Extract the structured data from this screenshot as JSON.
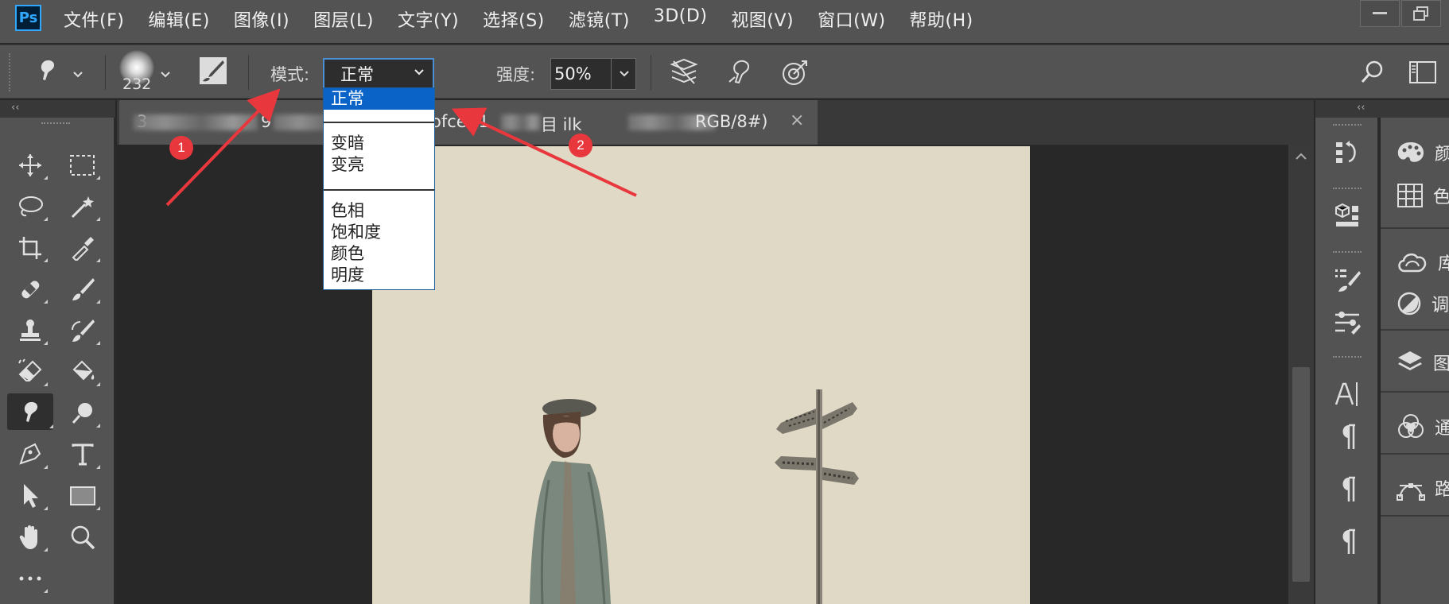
{
  "app": {
    "logo": "Ps"
  },
  "menu": [
    "文件(F)",
    "编辑(E)",
    "图像(I)",
    "图层(L)",
    "文字(Y)",
    "选择(S)",
    "滤镜(T)",
    "3D(D)",
    "视图(V)",
    "窗口(W)",
    "帮助(H)"
  ],
  "options": {
    "brush_size": "232",
    "mode_label": "模式:",
    "mode_value": "正常",
    "strength_label": "强度:",
    "strength_value": "50%"
  },
  "mode_dropdown": {
    "options": [
      "正常",
      "变暗",
      "变亮",
      "色相",
      "饱和度",
      "颜色",
      "明度"
    ],
    "selected": "正常"
  },
  "document_tab": {
    "title_fragments": [
      "3",
      "9",
      "ofce (1",
      "目 ilk",
      "RGB/8#)"
    ],
    "close": "×"
  },
  "annotations": {
    "badge_1": "1",
    "badge_2": "2",
    "color": "#e8383d"
  },
  "right_panels": [
    {
      "icon": "palette-icon",
      "label": "颜"
    },
    {
      "icon": "swatches-icon",
      "label": "色"
    },
    {
      "icon": "cc-libraries-icon",
      "label": "库"
    },
    {
      "icon": "adjustments-icon",
      "label": "调"
    },
    {
      "icon": "layers-icon",
      "label": "图"
    },
    {
      "icon": "channels-icon",
      "label": "通"
    },
    {
      "icon": "paths-icon",
      "label": "路"
    }
  ],
  "tools": [
    "move-tool",
    "marquee-tool",
    "lasso-tool",
    "magic-wand-tool",
    "crop-tool",
    "eyedropper-tool",
    "healing-tool",
    "brush-tool",
    "stamp-tool",
    "history-brush-tool",
    "eraser-tool",
    "paint-bucket-tool",
    "smudge-tool",
    "dodge-tool",
    "pen-tool",
    "type-tool",
    "path-select-tool",
    "rectangle-tool",
    "hand-tool",
    "zoom-tool",
    "more-tools"
  ],
  "colors": {
    "ui_bg": "#535353",
    "dark_bg": "#282828",
    "selection": "#0a64c8",
    "artboard": "#e0d9c5"
  }
}
